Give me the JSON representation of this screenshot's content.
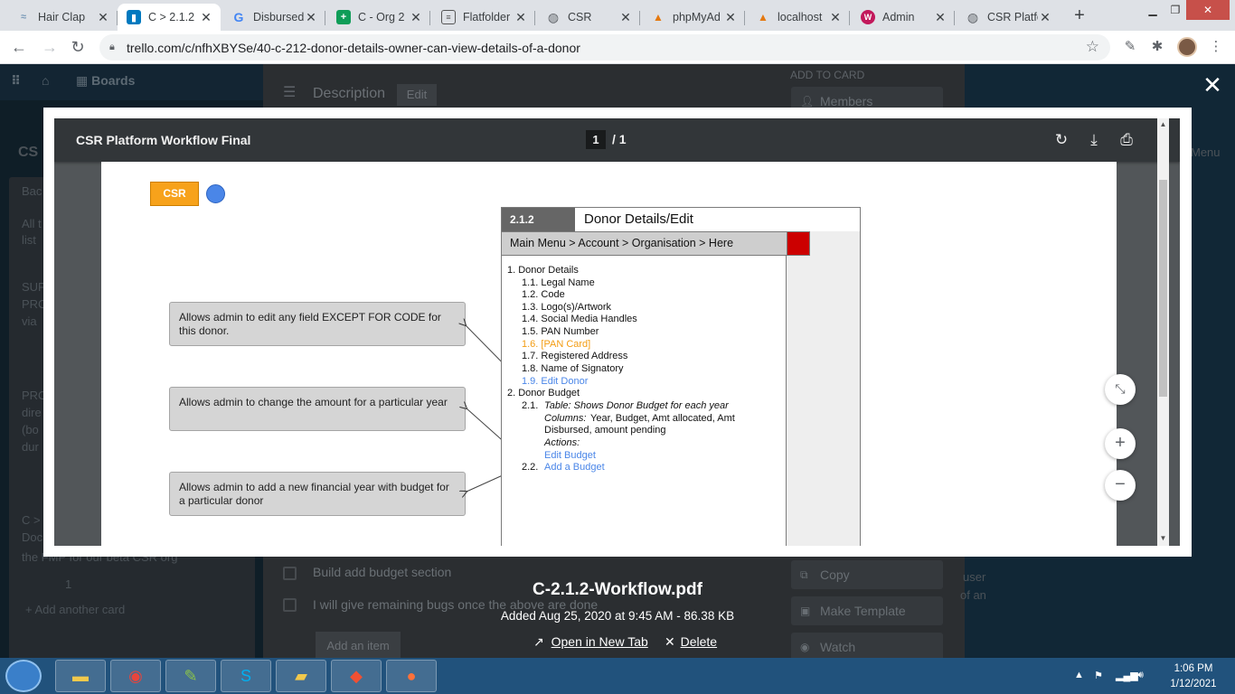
{
  "browser": {
    "tabs": [
      {
        "title": "Hair Clap",
        "favicon": "wave-icon"
      },
      {
        "title": "C > 2.1.2",
        "favicon": "trello-icon",
        "active": true
      },
      {
        "title": "Disbursed",
        "favicon": "google-icon"
      },
      {
        "title": "C - Org 2",
        "favicon": "sheets-icon"
      },
      {
        "title": "Flatfolder",
        "favicon": "doc-icon"
      },
      {
        "title": "CSR",
        "favicon": "globe-icon"
      },
      {
        "title": "phpMyAd",
        "favicon": "phpmyadmin-icon"
      },
      {
        "title": "localhost",
        "favicon": "phpmyadmin-icon"
      },
      {
        "title": "Admin",
        "favicon": "admin-icon"
      },
      {
        "title": "CSR Platfo",
        "favicon": "globe-icon"
      }
    ],
    "new_tab": "+",
    "url": "trello.com/c/nfhXBYSe/40-c-212-donor-details-owner-can-view-details-of-a-donor"
  },
  "trello": {
    "boardbar": {
      "boards_label": "Boards"
    },
    "list_title": "CS",
    "list_lines": [
      "Bac",
      "All t",
      "list",
      "SUP",
      "PRC",
      "via",
      "PRO",
      "dire",
      "(bo",
      "dur",
      "C >",
      "Doc",
      "the FMP for our beta CSR org"
    ],
    "count": "1",
    "add_card": "+ Add another card",
    "description_label": "Description",
    "edit_label": "Edit",
    "add_to_card": "ADD TO CARD",
    "members": "Members",
    "menu_label": "Menu",
    "checklist": [
      "Build add budget section",
      "I will give remaining bugs once the above are done"
    ],
    "add_item": "Add an item",
    "side_actions": [
      "Copy",
      "Make Template",
      "Watch"
    ],
    "right_text": [
      "user",
      "of an"
    ]
  },
  "viewer": {
    "doc_title": "CSR Platform Workflow Final",
    "page_current": "1",
    "page_total": "/ 1"
  },
  "pdf": {
    "badge": "CSR",
    "screen_id": "2.1.2",
    "screen_title": "Donor Details/Edit",
    "breadcrumb": "Main Menu > Account > Organisation > Here",
    "notes": [
      "Allows admin to edit any field EXCEPT FOR CODE for this donor.",
      "Allows admin to change the amount for a particular year",
      "Allows admin to add a new financial year with budget for a particular donor"
    ],
    "outline": {
      "s1": "1.  Donor Details",
      "s1_1": "1.1.  Legal Name",
      "s1_2": "1.2.  Code",
      "s1_3": "1.3.  Logo(s)/Artwork",
      "s1_4": "1.4.  Social Media Handles",
      "s1_5": "1.5.  PAN Number",
      "s1_6": "1.6.  [PAN Card]",
      "s1_7": "1.7.  Registered Address",
      "s1_8": "1.8.  Name of Signatory",
      "s1_9": "1.9.  Edit Donor",
      "s2": "2.  Donor Budget",
      "s2_1_num": "2.1.",
      "s2_1_italic": "Table: Shows Donor Budget for each year",
      "s2_1_cols_label": "Columns:",
      "s2_1_cols": "Year, Budget, Amt allocated, Amt",
      "s2_1_cols2": "Disbursed, amount pending",
      "s2_1_actions": "Actions:",
      "s2_1_edit": "Edit Budget",
      "s2_2_num": "2.2.",
      "s2_2": "Add a Budget"
    }
  },
  "file": {
    "name": "C-2.1.2-Workflow.pdf",
    "added": "Added Aug 25, 2020 at 9:45 AM - 86.38 KB",
    "open_new_tab": "Open in New Tab",
    "delete": "Delete"
  },
  "taskbar": {
    "time": "1:06 PM",
    "date": "1/12/2021"
  },
  "colors": {
    "accent_orange": "#f7a21b",
    "link_blue": "#4a86e8",
    "red_marker": "#cc0000",
    "viewer_bar": "#323639"
  }
}
